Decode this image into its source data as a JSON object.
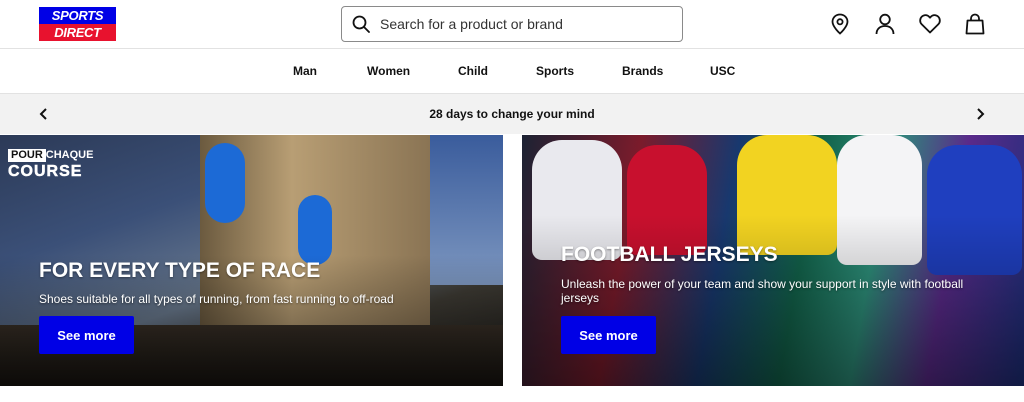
{
  "header": {
    "logo_top": "SPORTS",
    "logo_bottom": "DIRECT",
    "search_placeholder": "Search for a product or brand",
    "icons": [
      "search-icon",
      "location-pin-icon",
      "account-icon",
      "heart-icon",
      "bag-icon"
    ]
  },
  "nav": {
    "items": [
      {
        "label": "Man"
      },
      {
        "label": "Women"
      },
      {
        "label": "Child"
      },
      {
        "label": "Sports"
      },
      {
        "label": "Brands"
      },
      {
        "label": "USC"
      }
    ]
  },
  "promo": {
    "text": "28 days to change your mind",
    "prev_icon": "chevron-left-icon",
    "next_icon": "chevron-right-icon"
  },
  "banners": [
    {
      "tag_line1": "POUR",
      "tag_line1b": "CHAQUE",
      "tag_line2": "COURSE",
      "title": "FOR EVERY TYPE OF RACE",
      "subtitle": "Shoes suitable for all types of running, from fast running to off-road",
      "button": "See more"
    },
    {
      "title": "FOOTBALL JERSEYS",
      "subtitle": "Unleash the power of your team and show your support in style with football jerseys",
      "button": "See more"
    }
  ],
  "colors": {
    "brand_blue": "#0000e6",
    "brand_red": "#e8122e",
    "promo_bg": "#f2f2f2"
  }
}
